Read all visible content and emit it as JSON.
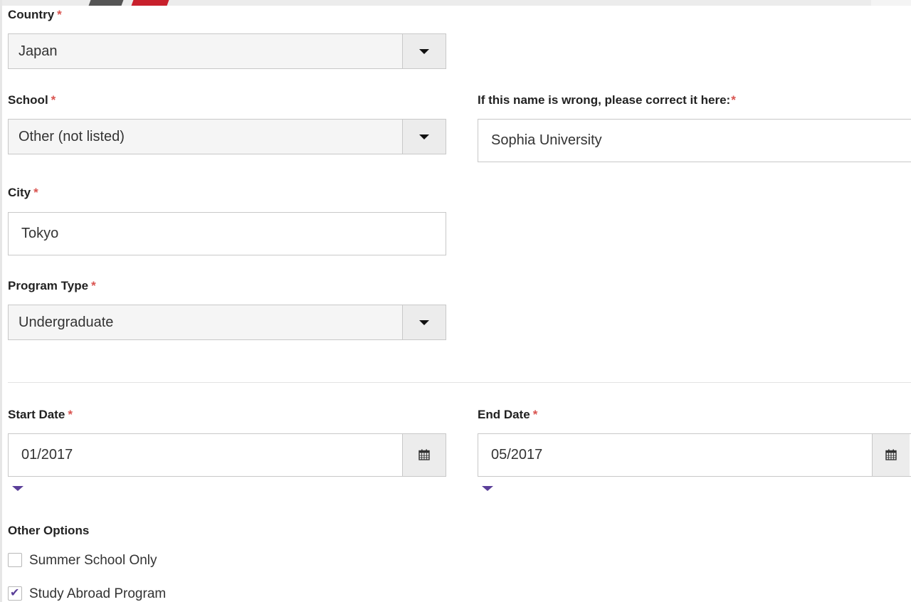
{
  "form": {
    "country": {
      "label": "Country",
      "required": "*",
      "value": "Japan"
    },
    "school": {
      "label": "School",
      "required": "*",
      "value": "Other (not listed)"
    },
    "school_correction": {
      "label": "If this name is wrong, please correct it here:",
      "required": "*",
      "value": "Sophia University"
    },
    "city": {
      "label": "City",
      "required": "*",
      "value": "Tokyo"
    },
    "program_type": {
      "label": "Program Type",
      "required": "*",
      "value": "Undergraduate"
    },
    "start_date": {
      "label": "Start Date",
      "required": "*",
      "value": "01/2017"
    },
    "end_date": {
      "label": "End Date",
      "required": "*",
      "value": "05/2017"
    },
    "other_options": {
      "label": "Other Options",
      "options": [
        {
          "label": "Summer School Only",
          "checked": false
        },
        {
          "label": "Study Abroad Program",
          "checked": true
        }
      ]
    }
  },
  "icons": {
    "dropdown": "chevron-down-icon",
    "date": "calendar-icon",
    "checked": "checkmark-icon"
  },
  "colors": {
    "required": "#d9534f",
    "accent": "#5b3f99",
    "border": "#c8c8c8",
    "addon_bg": "#ececec"
  }
}
